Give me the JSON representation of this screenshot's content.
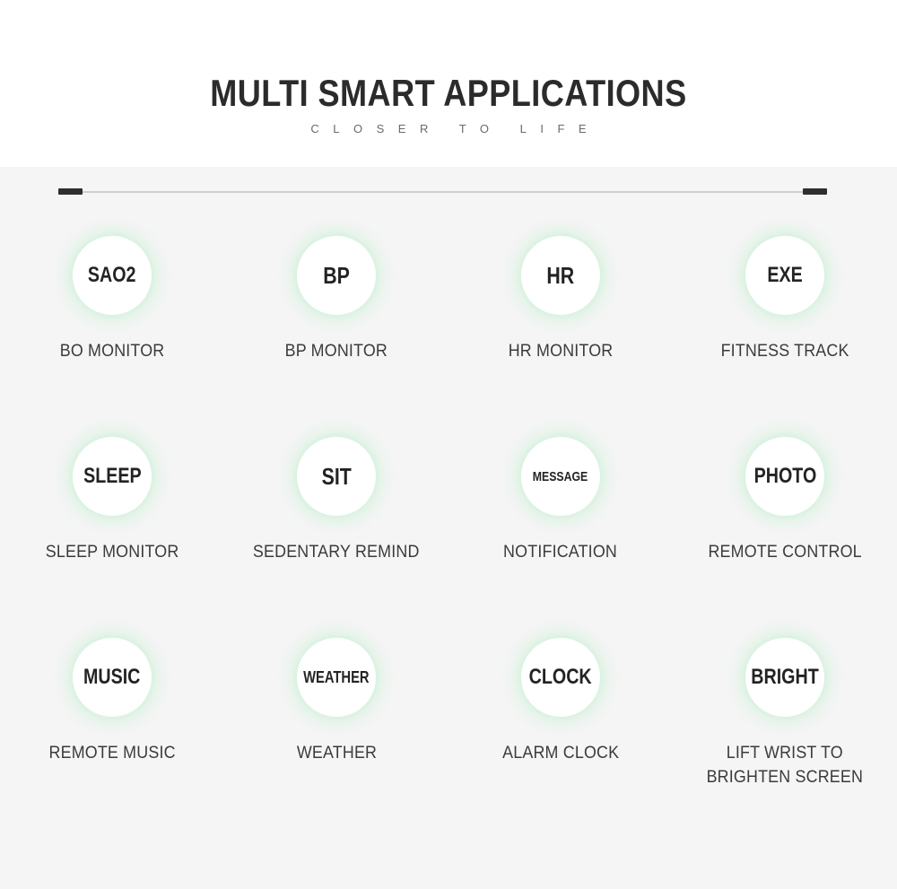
{
  "header": {
    "title": "MULTI SMART APPLICATIONS",
    "subtitle": "CLOSER TO LIFE"
  },
  "colors": {
    "header_bg": "#ffffff",
    "body_bg": "#f5f5f5",
    "glow_green": "#68e28c",
    "badge_bg": "#ffffff",
    "title_text": "#2b2b2b",
    "subtitle_text": "#6a6a6a",
    "label_text": "#3b3b3b",
    "divider_line": "#cfcfcf",
    "divider_cap": "#2e2e2e"
  },
  "divider": {
    "name": "section-divider"
  },
  "features": [
    {
      "badge": "SAO2",
      "badge_size": "sz-md",
      "label": "BO MONITOR",
      "icon_name": "sao2-badge-icon"
    },
    {
      "badge": "BP",
      "badge_size": "sz-lg",
      "label": "BP MONITOR",
      "icon_name": "bp-badge-icon"
    },
    {
      "badge": "HR",
      "badge_size": "sz-lg",
      "label": "HR MONITOR",
      "icon_name": "hr-badge-icon"
    },
    {
      "badge": "EXE",
      "badge_size": "sz-md",
      "label": "FITNESS TRACK",
      "icon_name": "exe-badge-icon"
    },
    {
      "badge": "SLEEP",
      "badge_size": "sz-md",
      "label": "SLEEP MONITOR",
      "icon_name": "sleep-badge-icon"
    },
    {
      "badge": "SIT",
      "badge_size": "sz-lg",
      "label": "SEDENTARY REMIND",
      "icon_name": "sit-badge-icon"
    },
    {
      "badge": "MESSAGE",
      "badge_size": "sz-xs",
      "label": "NOTIFICATION",
      "icon_name": "message-badge-icon"
    },
    {
      "badge": "PHOTO",
      "badge_size": "sz-md",
      "label": "REMOTE CONTROL",
      "icon_name": "photo-badge-icon"
    },
    {
      "badge": "MUSIC",
      "badge_size": "sz-md",
      "label": "REMOTE MUSIC",
      "icon_name": "music-badge-icon"
    },
    {
      "badge": "WEATHER",
      "badge_size": "sz-sm",
      "label": "WEATHER",
      "icon_name": "weather-badge-icon"
    },
    {
      "badge": "CLOCK",
      "badge_size": "sz-md",
      "label": "ALARM CLOCK",
      "icon_name": "clock-badge-icon"
    },
    {
      "badge": "BRIGHT",
      "badge_size": "sz-md",
      "label": "LIFT WRIST TO\nBRIGHTEN SCREEN",
      "icon_name": "bright-badge-icon"
    }
  ]
}
